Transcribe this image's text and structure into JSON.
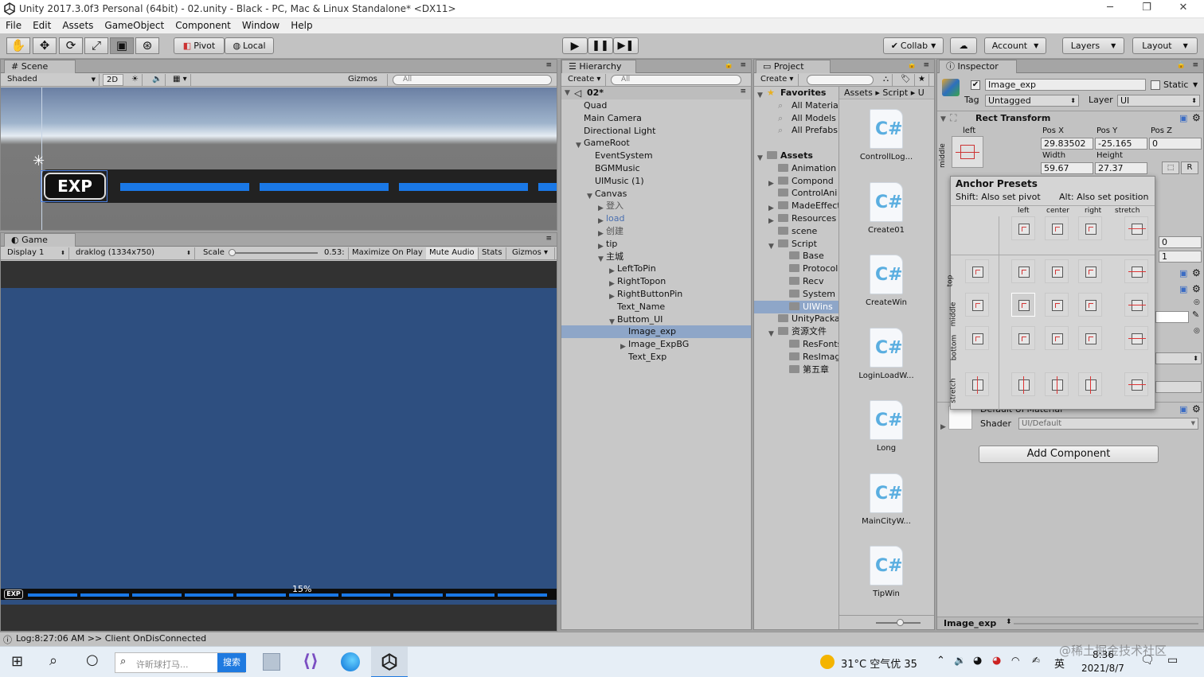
{
  "window": {
    "title": "Unity 2017.3.0f3 Personal (64bit) - 02.unity - Black - PC, Mac & Linux Standalone* <DX11>",
    "minimize": "─",
    "restore": "❐",
    "close": "✕"
  },
  "menu": [
    "File",
    "Edit",
    "Assets",
    "GameObject",
    "Component",
    "Window",
    "Help"
  ],
  "toolbar": {
    "pivot": "Pivot",
    "local": "Local",
    "collab": "Collab",
    "account": "Account",
    "layers": "Layers",
    "layout": "Layout"
  },
  "scene": {
    "tab": "Scene",
    "shading": "Shaded",
    "mode2d": "2D",
    "gizmos": "Gizmos",
    "search_placeholder": "All",
    "exp_label": "EXP"
  },
  "game": {
    "tab": "Game",
    "display": "Display 1",
    "resolution": "draklog (1334x750)",
    "scale_label": "Scale",
    "scale_value": "0.53:",
    "maximize": "Maximize On Play",
    "mute": "Mute Audio",
    "stats": "Stats",
    "gizmos": "Gizmos",
    "exp_label": "EXP",
    "progress_text": "15%",
    "progress": 0.15
  },
  "hierarchy": {
    "tab": "Hierarchy",
    "create": "Create",
    "search_placeholder": "All",
    "scene_name": "02*",
    "items": [
      {
        "label": "Quad",
        "depth": 1,
        "arrow": ""
      },
      {
        "label": "Main Camera",
        "depth": 1,
        "arrow": ""
      },
      {
        "label": "Directional Light",
        "depth": 1,
        "arrow": ""
      },
      {
        "label": "GameRoot",
        "depth": 1,
        "arrow": "▼"
      },
      {
        "label": "EventSystem",
        "depth": 2,
        "arrow": ""
      },
      {
        "label": "BGMMusic",
        "depth": 2,
        "arrow": ""
      },
      {
        "label": "UIMusic (1)",
        "depth": 2,
        "arrow": ""
      },
      {
        "label": "Canvas",
        "depth": 2,
        "arrow": "▼"
      },
      {
        "label": "登入",
        "depth": 3,
        "arrow": "▶"
      },
      {
        "label": "load",
        "depth": 3,
        "arrow": "▶"
      },
      {
        "label": "创建",
        "depth": 3,
        "arrow": "▶"
      },
      {
        "label": "tip",
        "depth": 3,
        "arrow": "▶"
      },
      {
        "label": "主城",
        "depth": 3,
        "arrow": "▼"
      },
      {
        "label": "LeftToPin",
        "depth": 4,
        "arrow": "▶"
      },
      {
        "label": "RightTopon",
        "depth": 4,
        "arrow": "▶"
      },
      {
        "label": "RightButtonPin",
        "depth": 4,
        "arrow": "▶"
      },
      {
        "label": "Text_Name",
        "depth": 4,
        "arrow": ""
      },
      {
        "label": "Buttom_UI",
        "depth": 4,
        "arrow": "▼"
      },
      {
        "label": "Image_exp",
        "depth": 5,
        "arrow": ""
      },
      {
        "label": "Image_ExpBG",
        "depth": 5,
        "arrow": "▶"
      },
      {
        "label": "Text_Exp",
        "depth": 5,
        "arrow": ""
      }
    ]
  },
  "project": {
    "tab": "Project",
    "create": "Create",
    "breadcrumb": [
      "Assets",
      "Script",
      "U"
    ],
    "tree": [
      {
        "label": "Favorites",
        "depth": 0,
        "arrow": "▼",
        "kind": "fav-root"
      },
      {
        "label": "All Materia",
        "depth": 1,
        "arrow": "",
        "kind": "fav"
      },
      {
        "label": "All Models",
        "depth": 1,
        "arrow": "",
        "kind": "fav"
      },
      {
        "label": "All Prefabs",
        "depth": 1,
        "arrow": "",
        "kind": "fav"
      },
      {
        "label": "",
        "depth": 0,
        "arrow": "",
        "kind": "gap"
      },
      {
        "label": "Assets",
        "depth": 0,
        "arrow": "▼",
        "kind": "root"
      },
      {
        "label": "Animation",
        "depth": 1,
        "arrow": "",
        "kind": "folder"
      },
      {
        "label": "Compond",
        "depth": 1,
        "arrow": "▶",
        "kind": "folder"
      },
      {
        "label": "ControlAni",
        "depth": 1,
        "arrow": "",
        "kind": "folder"
      },
      {
        "label": "MadeEffect",
        "depth": 1,
        "arrow": "▶",
        "kind": "folder"
      },
      {
        "label": "Resources",
        "depth": 1,
        "arrow": "▶",
        "kind": "folder"
      },
      {
        "label": "scene",
        "depth": 1,
        "arrow": "",
        "kind": "folder"
      },
      {
        "label": "Script",
        "depth": 1,
        "arrow": "▼",
        "kind": "folder"
      },
      {
        "label": "Base",
        "depth": 2,
        "arrow": "",
        "kind": "folder"
      },
      {
        "label": "Protocol",
        "depth": 2,
        "arrow": "",
        "kind": "folder"
      },
      {
        "label": "Recv",
        "depth": 2,
        "arrow": "",
        "kind": "folder"
      },
      {
        "label": "System",
        "depth": 2,
        "arrow": "",
        "kind": "folder"
      },
      {
        "label": "UIWins",
        "depth": 2,
        "arrow": "",
        "kind": "folder-sel"
      },
      {
        "label": "UnityPacka",
        "depth": 1,
        "arrow": "",
        "kind": "folder"
      },
      {
        "label": "资源文件",
        "depth": 1,
        "arrow": "▼",
        "kind": "folder"
      },
      {
        "label": "ResFonts",
        "depth": 2,
        "arrow": "",
        "kind": "folder"
      },
      {
        "label": "ResImag",
        "depth": 2,
        "arrow": "",
        "kind": "folder"
      },
      {
        "label": "第五章",
        "depth": 2,
        "arrow": "",
        "kind": "folder"
      }
    ],
    "files": [
      "ControllLog...",
      "Create01",
      "CreateWin",
      "LoginLoadW...",
      "Long",
      "MainCityW...",
      "TipWin"
    ],
    "footer": "Image_exp"
  },
  "inspector": {
    "tab": "Inspector",
    "object_name": "Image_exp",
    "static_label": "Static",
    "tag_label": "Tag",
    "tag_value": "Untagged",
    "layer_label": "Layer",
    "layer_value": "UI",
    "rect_transform": "Rect Transform",
    "anchor_h": "left",
    "anchor_v": "middle",
    "pos_x_label": "Pos X",
    "pos_y_label": "Pos Y",
    "pos_z_label": "Pos Z",
    "pos_x": "29.83502",
    "pos_y": "-25.165",
    "pos_z": "0",
    "width_label": "Width",
    "height_label": "Height",
    "width": "59.67",
    "height": "27.37",
    "r_button": "R",
    "scale_x": "0",
    "scale_y": "1",
    "material_label": "Default UI Material",
    "shader_label": "Shader",
    "shader_value": "UI/Default",
    "add_component": "Add Component",
    "anchor_presets": {
      "title": "Anchor Presets",
      "shift_hint": "Shift: Also set pivot",
      "alt_hint": "Alt: Also set position",
      "cols": [
        "left",
        "center",
        "right",
        "stretch"
      ],
      "rows": [
        "top",
        "middle",
        "bottom",
        "stretch"
      ]
    }
  },
  "status": {
    "log": "Log:8:27:06 AM >> Client OnDisConnected"
  },
  "taskbar": {
    "search_placeholder": "许昕球打马...",
    "search_button": "搜索",
    "weather": "31°C 空气优 35",
    "ime": "英",
    "time": "8:36",
    "date": "2021/8/7",
    "watermark": "@稀土掘金技术社区"
  },
  "colors": {
    "unity_panel": "#c2c2c2",
    "game_bg": "#2e4f80",
    "exp_bar": "#1a78e6",
    "selected": "#8ea6c8",
    "anchor_red": "#d33333"
  }
}
